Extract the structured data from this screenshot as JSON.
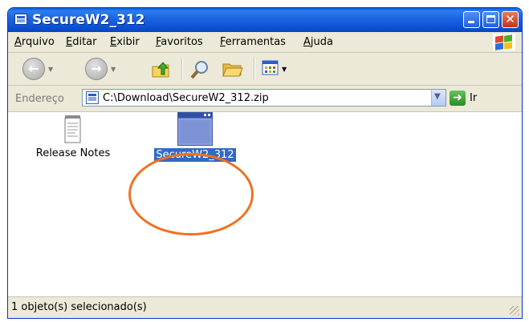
{
  "window": {
    "title": "SecureW2_312",
    "controls": {
      "minimize": "minimize",
      "maximize": "maximize",
      "close": "✕"
    }
  },
  "menu": {
    "items": [
      "Arquivo",
      "Editar",
      "Exibir",
      "Favoritos",
      "Ferramentas",
      "Ajuda"
    ]
  },
  "toolbar": {
    "back_icon": "back-arrow-icon",
    "forward_icon": "forward-arrow-icon",
    "up_icon": "up-folder-icon",
    "search_icon": "search-icon",
    "folders_icon": "folders-icon",
    "views_icon": "views-icon"
  },
  "address": {
    "label": "Endereço",
    "value": "C:\\Download\\SecureW2_312.zip",
    "go_label": "Ir"
  },
  "files": [
    {
      "name": "Release Notes",
      "icon": "text-document-icon",
      "selected": false
    },
    {
      "name": "SecureW2_312",
      "icon": "application-window-icon",
      "selected": true
    }
  ],
  "status": {
    "text": "1 objeto(s) selecionado(s)"
  },
  "colors": {
    "titlebar": "#1e67e3",
    "selection": "#316ac5",
    "annotation": "#ef7121",
    "chrome": "#ece9d8"
  }
}
